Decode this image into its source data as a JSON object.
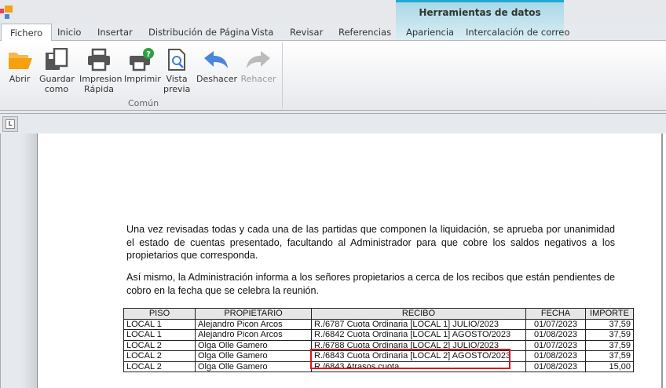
{
  "ribbon_tabs": [
    "Fichero",
    "Inicio",
    "Insertar",
    "Distribución de Página",
    "Vista",
    "Revisar",
    "Referencias",
    "Apariencia",
    "Intercalación de correo"
  ],
  "context_tab_title": "Herramientas de datos",
  "buttons": {
    "abrir": "Abrir",
    "guardar": "Guardar",
    "guardar2": "como",
    "impresion": "Impresion",
    "impresion2": "Rápida",
    "imprimir": "Imprimir",
    "vista": "Vista",
    "vista2": "previa",
    "deshacer": "Deshacer",
    "rehacer": "Rehacer"
  },
  "group_label": "Común",
  "ruler_icon": "L",
  "document": {
    "para1": "Una vez revisadas todas y cada una de las partidas que componen la liquidación, se aprueba por unanimidad el estado de cuentas presentado, facultando al Administrador para que cobre los saldos negativos a los propietarios que corresponda.",
    "para2": "Así mismo, la Administración informa a los señores propietarios a cerca de los recibos que están pendientes de cobro en la fecha que se celebra la reunión.",
    "table": {
      "headers": [
        "PISO",
        "PROPIETARIO",
        "RECIBO",
        "FECHA",
        "IMPORTE"
      ],
      "rows": [
        [
          "LOCAL 1",
          "Alejandro Picon Arcos",
          "R./6787  Cuota Ordinaria [LOCAL 1] JULIO/2023",
          "01/07/2023",
          "37,59"
        ],
        [
          "LOCAL 1",
          "Alejandro Picon Arcos",
          "R./6842  Cuota Ordinaria [LOCAL 1] AGOSTO/2023",
          "01/08/2023",
          "37,59"
        ],
        [
          "LOCAL 2",
          "Olga Olle Gamero",
          "R./6788  Cuota Ordinaria [LOCAL 2] JULIO/2023",
          "01/07/2023",
          "37,59"
        ],
        [
          "LOCAL 2",
          "Olga Olle Gamero",
          "R./6843  Cuota Ordinaria [LOCAL 2] AGOSTO/2023",
          "01/08/2023",
          "37,59"
        ],
        [
          "LOCAL 2",
          "Olga Olle Gamero",
          "R./6843  Atrasos cuota",
          "01/08/2023",
          "15,00"
        ]
      ]
    }
  },
  "colors": {
    "accent": "#22a8d2",
    "highlight": "#e0141c"
  }
}
